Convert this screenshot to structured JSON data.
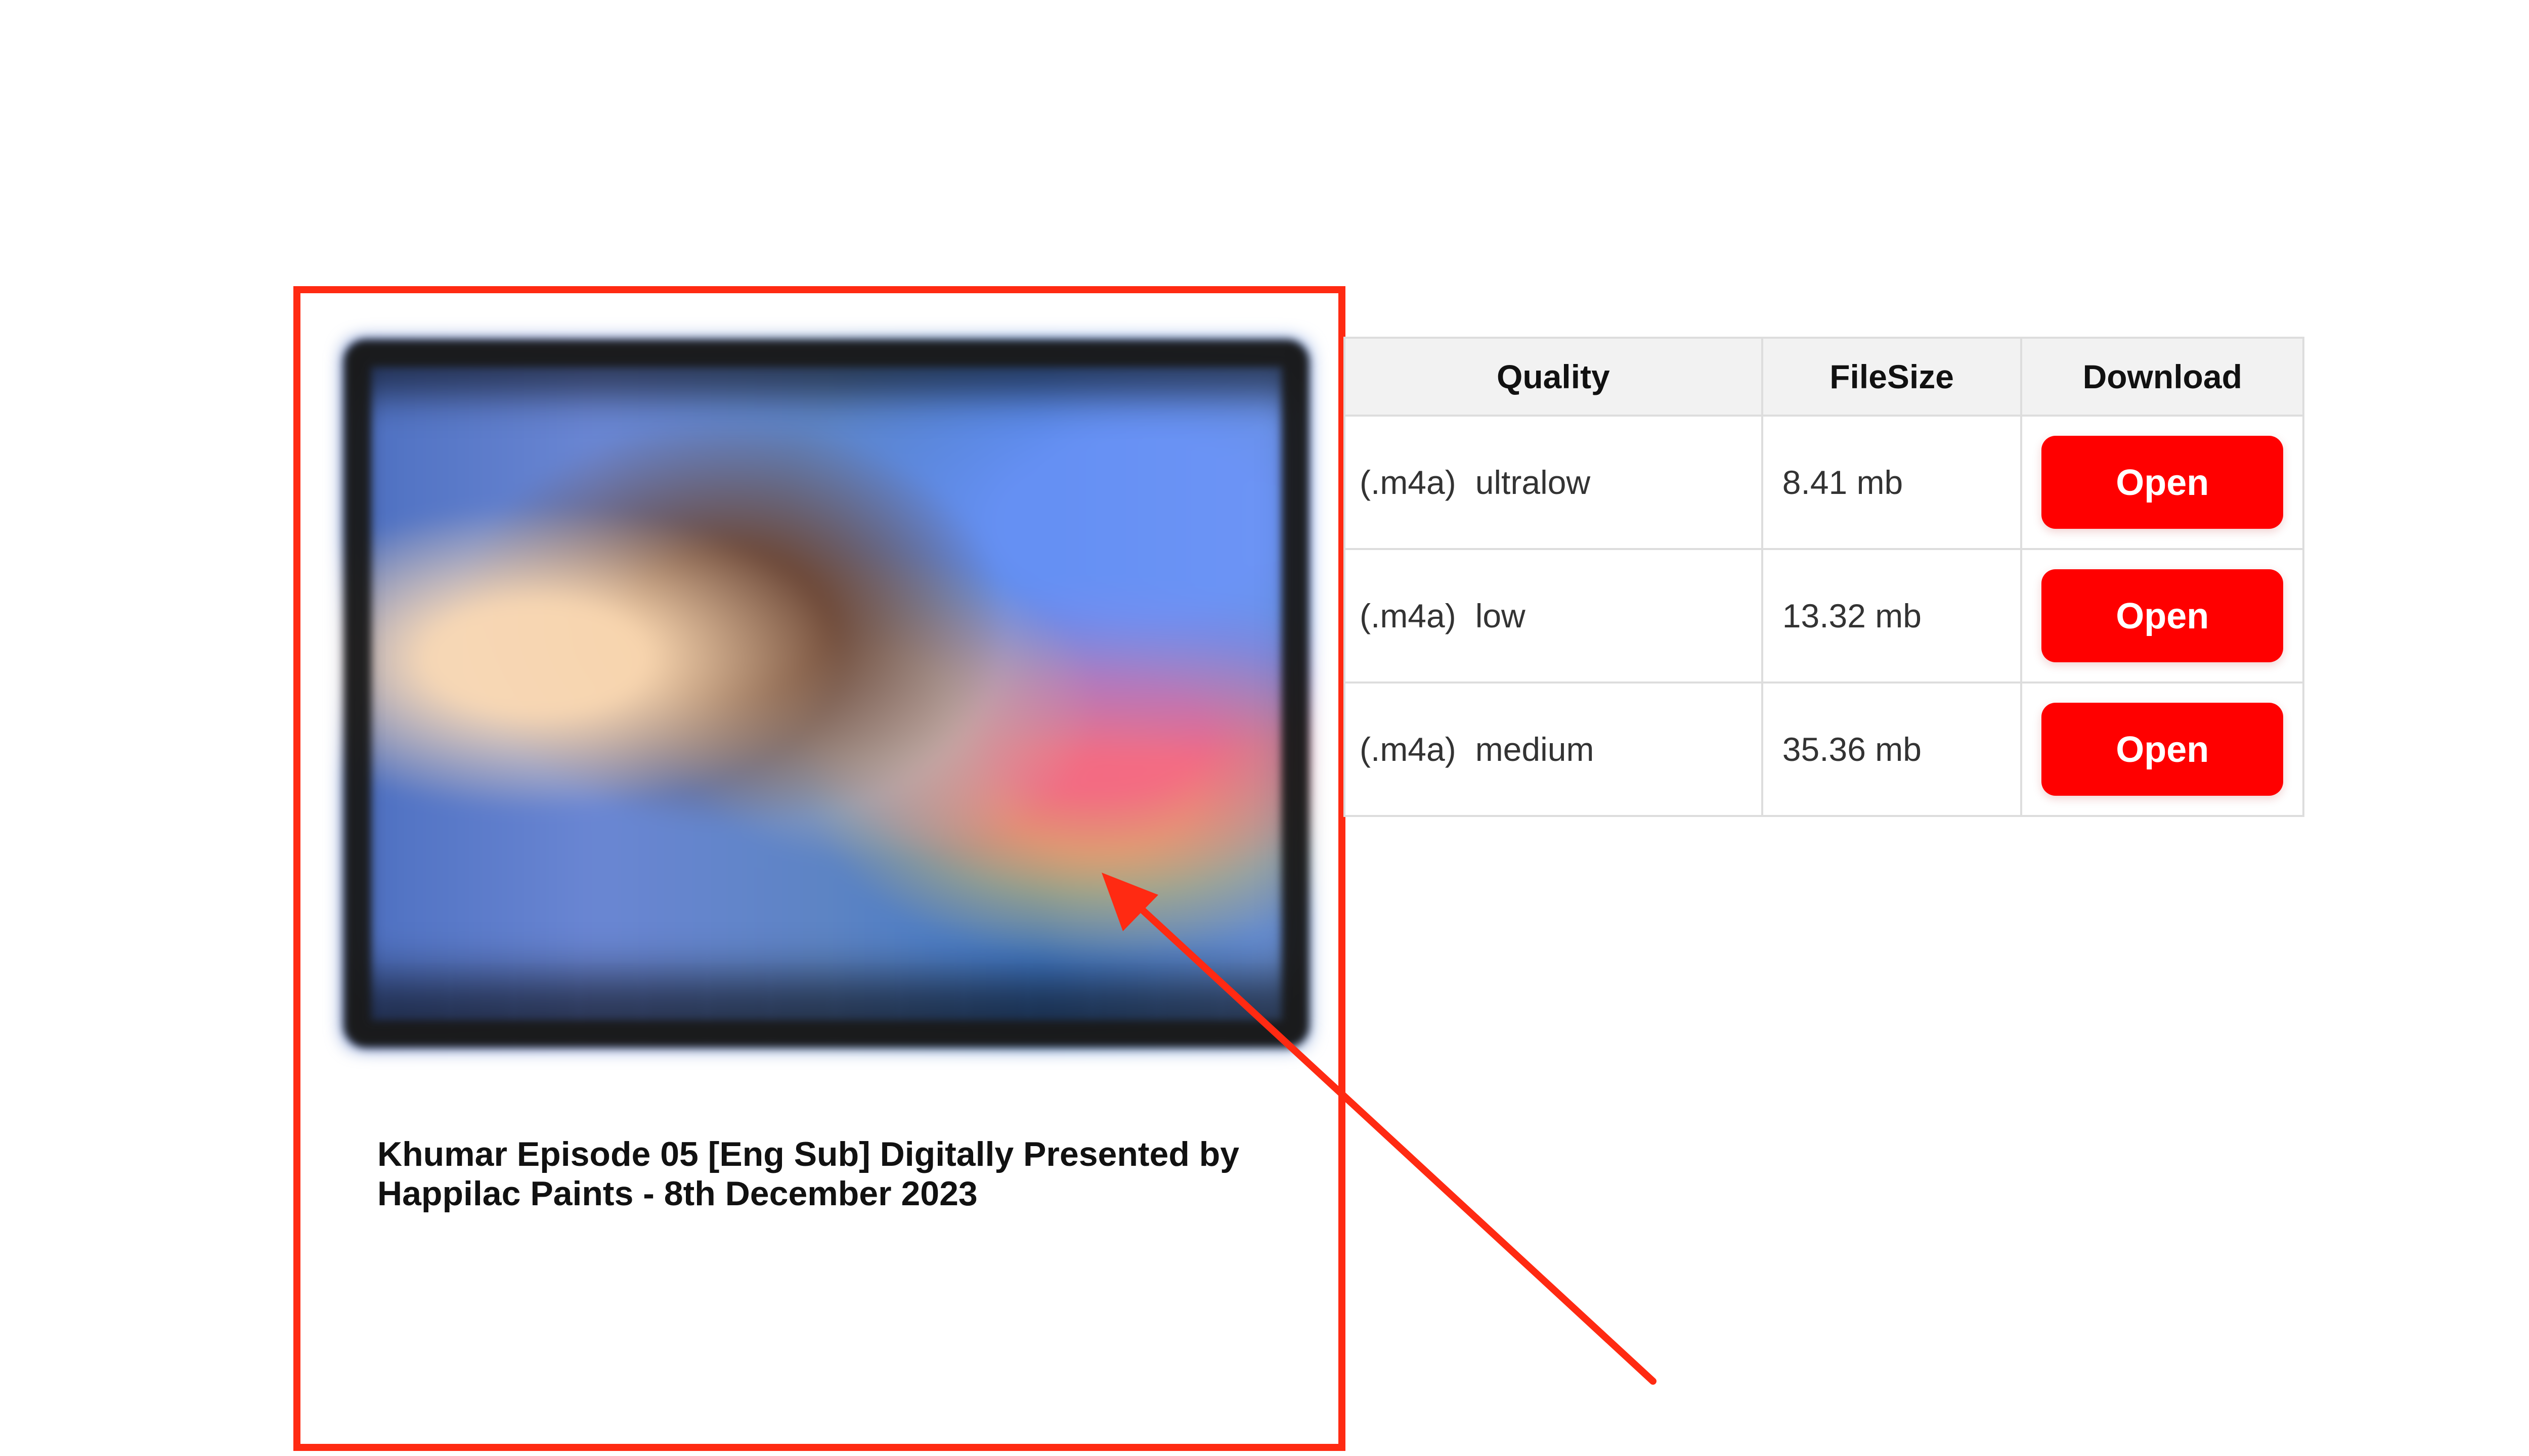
{
  "media": {
    "caption": "Khumar Episode 05 [Eng Sub] Digitally Presented by Happilac Paints - 8th December 2023"
  },
  "table": {
    "headers": [
      "Quality",
      "FileSize",
      "Download"
    ],
    "rows": [
      {
        "format": "(.m4a)",
        "quality": "ultralow",
        "size": "8.41 mb",
        "action": "Open"
      },
      {
        "format": "(.m4a)",
        "quality": "low",
        "size": "13.32 mb",
        "action": "Open"
      },
      {
        "format": "(.m4a)",
        "quality": "medium",
        "size": "35.36 mb",
        "action": "Open"
      }
    ]
  },
  "colors": {
    "highlight": "#ff2a12",
    "button": "#ff0000"
  }
}
